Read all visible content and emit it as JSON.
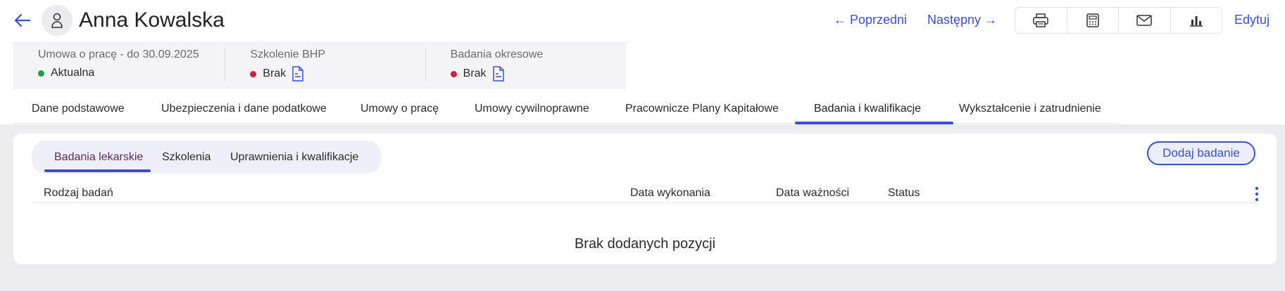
{
  "header": {
    "name": "Anna Kowalska",
    "prev_label": "← Poprzedni",
    "next_label": "Następny →",
    "edit_label": "Edytuj",
    "tools": [
      "printer-icon",
      "calculator-icon",
      "mail-icon",
      "bar-chart-icon"
    ]
  },
  "summary": {
    "contract": {
      "label": "Umowa o pracę - do 30.09.2025",
      "status": "Aktualna",
      "status_color": "#1e9e4a"
    },
    "bhp": {
      "label": "Szkolenie BHP",
      "status": "Brak",
      "status_color": "#d81b3c"
    },
    "medical": {
      "label": "Badania okresowe",
      "status": "Brak",
      "status_color": "#d81b3c"
    }
  },
  "tabs": [
    {
      "label": "Dane podstawowe"
    },
    {
      "label": "Ubezpieczenia i dane podatkowe"
    },
    {
      "label": "Umowy o pracę"
    },
    {
      "label": "Umowy cywilnoprawne"
    },
    {
      "label": "Pracownicze Plany Kapitałowe"
    },
    {
      "label": "Badania i kwalifikacje",
      "active": true
    },
    {
      "label": "Wykształcenie i zatrudnienie"
    }
  ],
  "subtabs": [
    {
      "label": "Badania lekarskie",
      "active": true
    },
    {
      "label": "Szkolenia"
    },
    {
      "label": "Uprawnienia i kwalifikacje"
    }
  ],
  "add_button": "Dodaj badanie",
  "table": {
    "columns": [
      "Rodzaj badań",
      "Data wykonania",
      "Data ważności",
      "Status"
    ],
    "empty_text": "Brak dodanych pozycji"
  },
  "colors": {
    "accent": "#3b4fd6",
    "page_bg": "#ededef"
  }
}
